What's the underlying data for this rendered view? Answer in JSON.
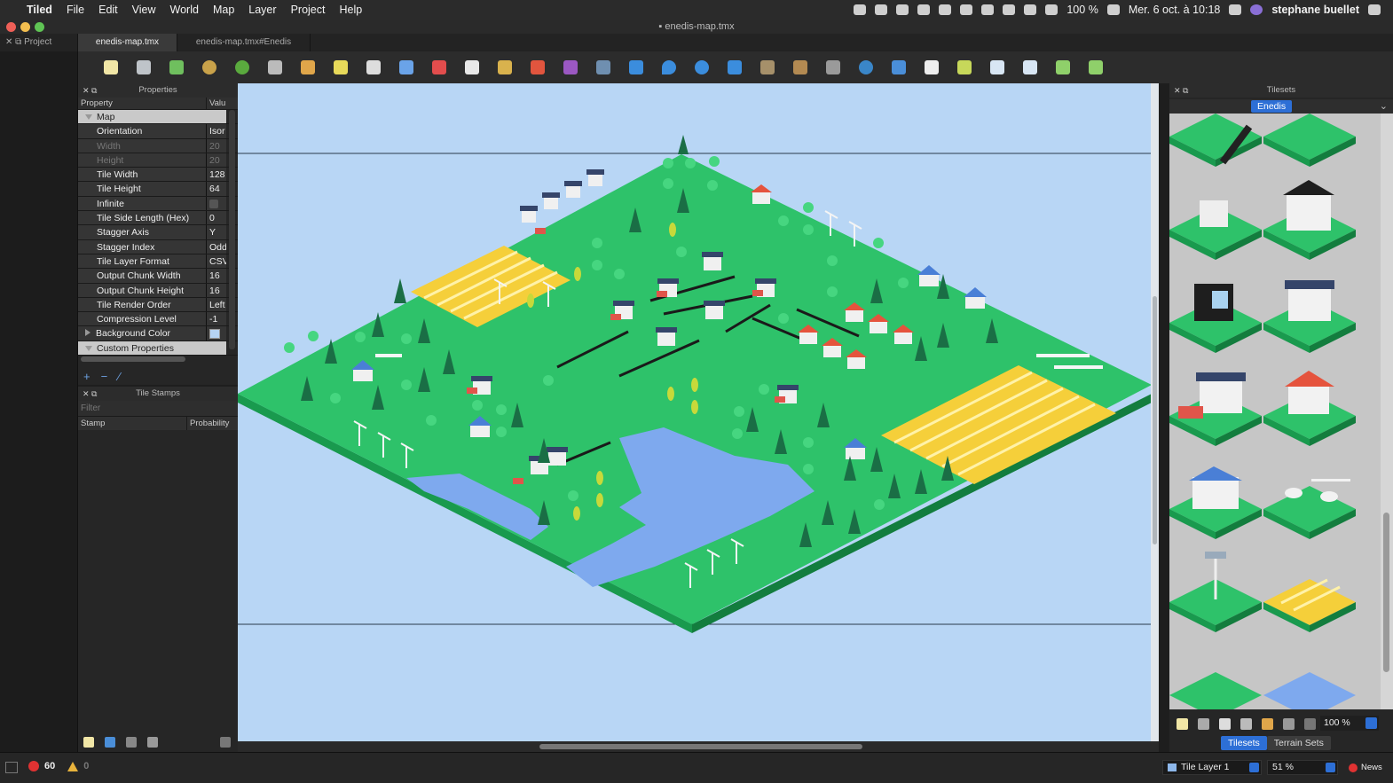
{
  "menubar": {
    "app": "Tiled",
    "items": [
      "File",
      "Edit",
      "View",
      "World",
      "Map",
      "Layer",
      "Project",
      "Help"
    ],
    "battery": "100 %",
    "datetime": "Mer. 6 oct. à 10:18",
    "user": "stephane buellet"
  },
  "window": {
    "title": "enedis-map.tmx"
  },
  "tabs": {
    "project": "Project",
    "map_tab": "enedis-map.tmx",
    "tileset_tab": "enedis-map.tmx#Enedis"
  },
  "properties": {
    "title": "Properties",
    "col_property": "Property",
    "col_value": "Valu",
    "group": "Map",
    "rows": [
      {
        "k": "Orientation",
        "v": "Isor"
      },
      {
        "k": "Width",
        "v": "20"
      },
      {
        "k": "Height",
        "v": "20"
      },
      {
        "k": "Tile Width",
        "v": "128"
      },
      {
        "k": "Tile Height",
        "v": "64"
      },
      {
        "k": "Infinite",
        "v": ""
      },
      {
        "k": "Tile Side Length (Hex)",
        "v": "0"
      },
      {
        "k": "Stagger Axis",
        "v": "Y"
      },
      {
        "k": "Stagger Index",
        "v": "Odd"
      },
      {
        "k": "Tile Layer Format",
        "v": "CSV"
      },
      {
        "k": "Output Chunk Width",
        "v": "16"
      },
      {
        "k": "Output Chunk Height",
        "v": "16"
      },
      {
        "k": "Tile Render Order",
        "v": "Left"
      },
      {
        "k": "Compression Level",
        "v": "-1"
      },
      {
        "k": "Background Color",
        "v": ""
      }
    ],
    "custom": "Custom Properties",
    "bg_color": "#b6d4f4"
  },
  "stamps": {
    "title": "Tile Stamps",
    "filter": "Filter",
    "col_stamp": "Stamp",
    "col_prob": "Probability"
  },
  "tilesets": {
    "title": "Tilesets",
    "selected": "Enedis",
    "zoom": "100 %",
    "tab_tilesets": "Tilesets",
    "tab_terrain": "Terrain Sets"
  },
  "status": {
    "errors": "60",
    "warnings": "0",
    "layer": "Tile Layer 1",
    "zoom": "51 %",
    "news": "News"
  },
  "colors": {
    "grass": "#2ec26a",
    "water": "#7ea9ee",
    "field": "#f5cf3a",
    "canvas_bg": "#b8d6f5",
    "accent": "#2d6fd6"
  }
}
